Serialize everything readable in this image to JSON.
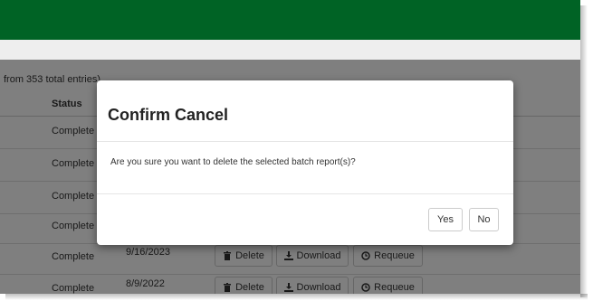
{
  "table": {
    "entries_info": "from 353 total entries)",
    "columns": {
      "status": "Status"
    },
    "rows": [
      {
        "status": "Complete",
        "date": ""
      },
      {
        "status": "Complete",
        "date": ""
      },
      {
        "status": "Complete",
        "date": ""
      },
      {
        "status": "Complete",
        "date": ""
      },
      {
        "status": "Complete",
        "date": "9/16/2023"
      },
      {
        "status": "Complete",
        "date": "8/9/2022"
      }
    ],
    "actions": {
      "delete_label": "Delete",
      "download_label": "Download",
      "requeue_label": "Requeue",
      "delete_icon": "trash-icon",
      "download_icon": "download-icon",
      "requeue_icon": "clock-icon"
    }
  },
  "dialog": {
    "title": "Confirm Cancel",
    "message": "Are you sure you want to delete the selected batch report(s)?",
    "yes_label": "Yes",
    "no_label": "No"
  },
  "colors": {
    "header": "#006325",
    "overlay": "rgba(0,0,0,0.5)"
  }
}
